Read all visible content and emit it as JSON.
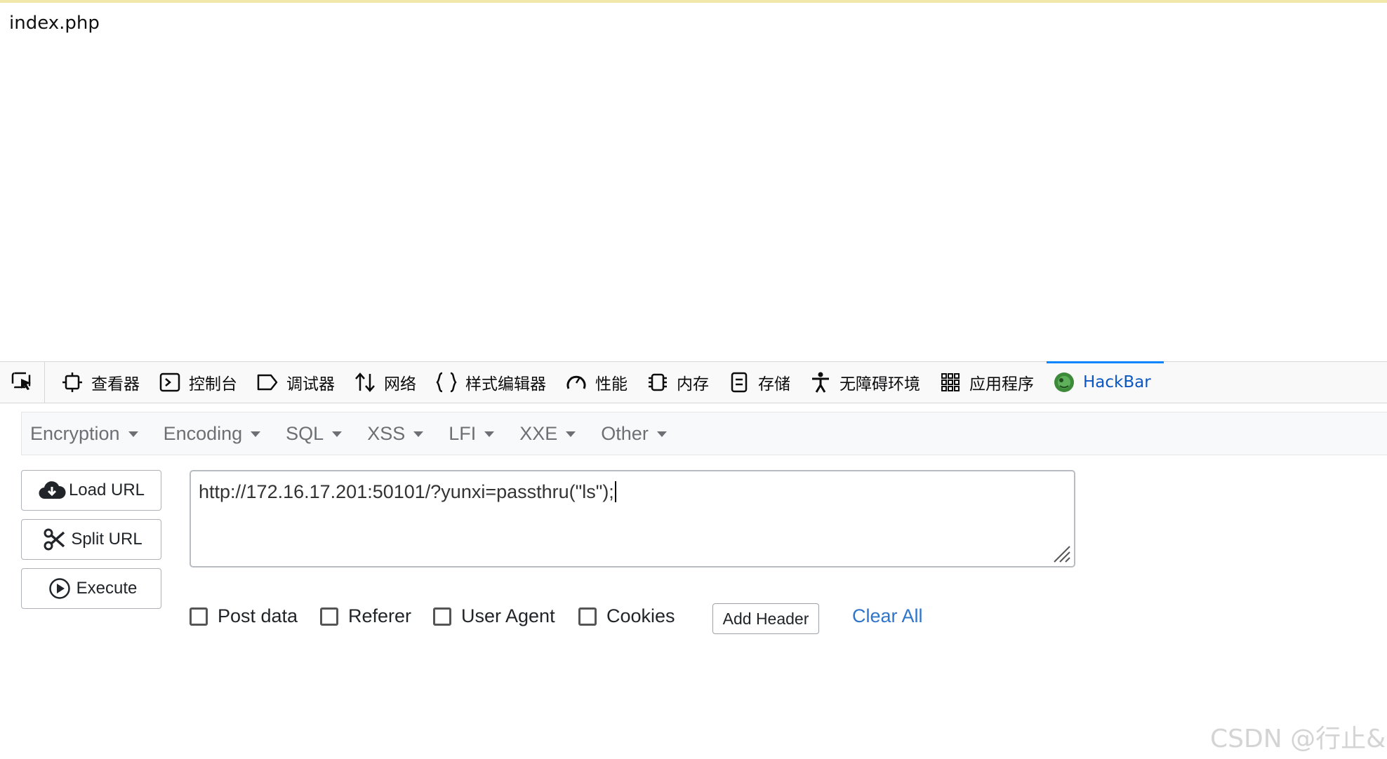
{
  "page": {
    "text": "index.php"
  },
  "devtools": {
    "tabs": [
      {
        "label": "查看器",
        "icon": "inspector-icon"
      },
      {
        "label": "控制台",
        "icon": "console-icon"
      },
      {
        "label": "调试器",
        "icon": "debugger-icon"
      },
      {
        "label": "网络",
        "icon": "network-icon"
      },
      {
        "label": "样式编辑器",
        "icon": "style-editor-icon"
      },
      {
        "label": "性能",
        "icon": "performance-icon"
      },
      {
        "label": "内存",
        "icon": "memory-icon"
      },
      {
        "label": "存储",
        "icon": "storage-icon"
      },
      {
        "label": "无障碍环境",
        "icon": "accessibility-icon"
      },
      {
        "label": "应用程序",
        "icon": "application-icon"
      },
      {
        "label": "HackBar",
        "icon": "hackbar-icon",
        "active": true
      }
    ],
    "active_color": "#0a56c2"
  },
  "hackbar": {
    "menu": [
      "Encryption",
      "Encoding",
      "SQL",
      "XSS",
      "LFI",
      "XXE",
      "Other"
    ],
    "buttons": {
      "load_url": "Load URL",
      "split_url": "Split URL",
      "execute": "Execute"
    },
    "url_value": "http://172.16.17.201:50101/?yunxi=passthru(\"ls\");",
    "options": {
      "post_data": "Post data",
      "referer": "Referer",
      "user_agent": "User Agent",
      "cookies": "Cookies"
    },
    "add_header": "Add Header",
    "clear_all": "Clear All",
    "link_color": "#2f75c9"
  },
  "watermark": "CSDN @行止&"
}
